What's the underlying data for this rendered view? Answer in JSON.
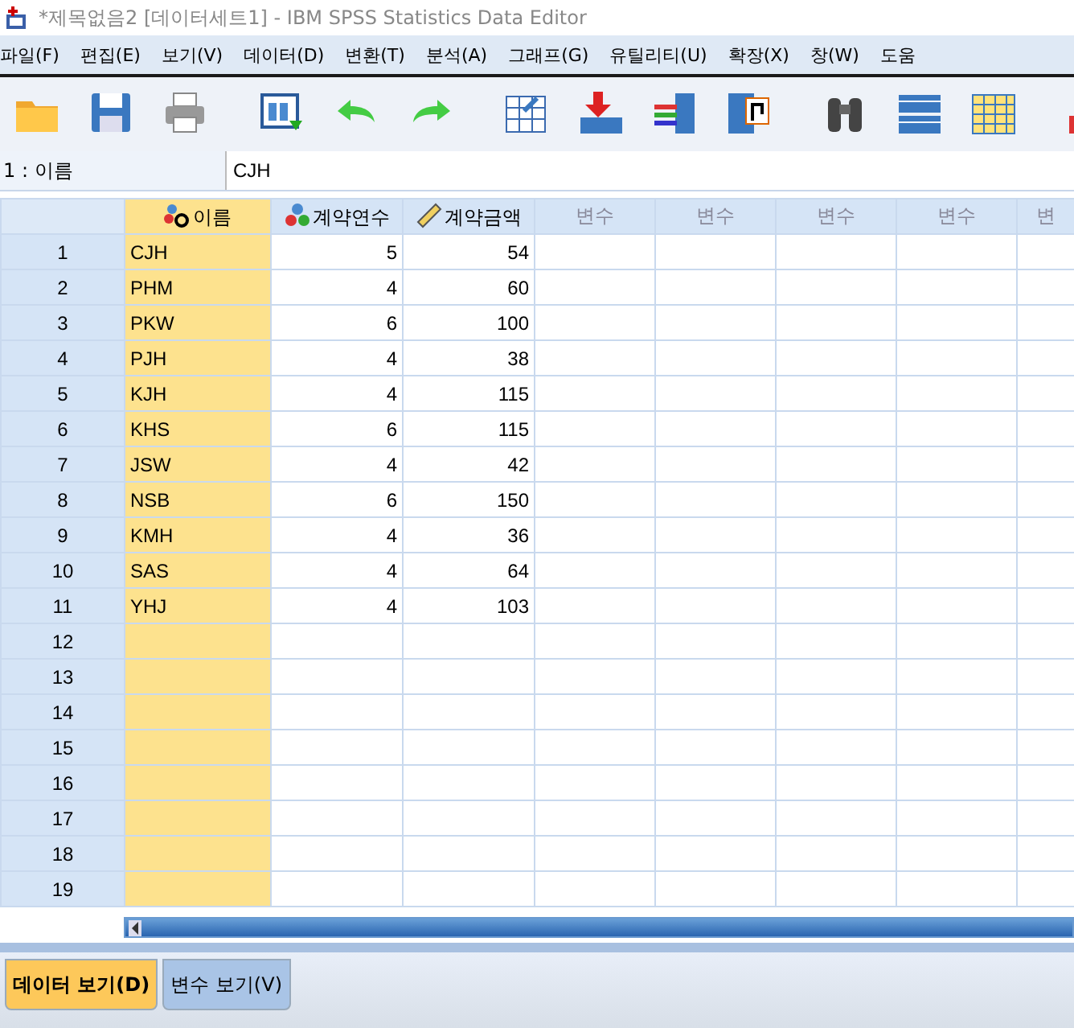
{
  "window": {
    "title": "*제목없음2 [데이터세트1] - IBM SPSS Statistics Data Editor"
  },
  "menu": [
    "파일(F)",
    "편집(E)",
    "보기(V)",
    "데이터(D)",
    "변환(T)",
    "분석(A)",
    "그래프(G)",
    "유틸리티(U)",
    "확장(X)",
    "창(W)",
    "도움"
  ],
  "cell_editor": {
    "reference": "1 : 이름",
    "value": "CJH"
  },
  "table": {
    "columns": [
      {
        "label": "이름",
        "kind": "nominal-string",
        "selected": true
      },
      {
        "label": "계약연수",
        "kind": "nominal",
        "selected": false
      },
      {
        "label": "계약금액",
        "kind": "scale",
        "selected": false
      },
      {
        "label": "변수",
        "kind": "empty",
        "selected": false
      },
      {
        "label": "변수",
        "kind": "empty",
        "selected": false
      },
      {
        "label": "변수",
        "kind": "empty",
        "selected": false
      },
      {
        "label": "변수",
        "kind": "empty",
        "selected": false
      },
      {
        "label": "변",
        "kind": "empty",
        "selected": false
      }
    ],
    "rows": [
      {
        "number": "1",
        "cells": [
          "CJH",
          "5",
          "54"
        ]
      },
      {
        "number": "2",
        "cells": [
          "PHM",
          "4",
          "60"
        ]
      },
      {
        "number": "3",
        "cells": [
          "PKW",
          "6",
          "100"
        ]
      },
      {
        "number": "4",
        "cells": [
          "PJH",
          "4",
          "38"
        ]
      },
      {
        "number": "5",
        "cells": [
          "KJH",
          "4",
          "115"
        ]
      },
      {
        "number": "6",
        "cells": [
          "KHS",
          "6",
          "115"
        ]
      },
      {
        "number": "7",
        "cells": [
          "JSW",
          "4",
          "42"
        ]
      },
      {
        "number": "8",
        "cells": [
          "NSB",
          "6",
          "150"
        ]
      },
      {
        "number": "9",
        "cells": [
          "KMH",
          "4",
          "36"
        ]
      },
      {
        "number": "10",
        "cells": [
          "SAS",
          "4",
          "64"
        ]
      },
      {
        "number": "11",
        "cells": [
          "YHJ",
          "4",
          "103"
        ]
      },
      {
        "number": "12"
      },
      {
        "number": "13"
      },
      {
        "number": "14"
      },
      {
        "number": "15"
      },
      {
        "number": "16"
      },
      {
        "number": "17"
      },
      {
        "number": "18"
      },
      {
        "number": "19"
      }
    ]
  },
  "tabs": [
    {
      "label": "데이터 보기(D)",
      "selected": true
    },
    {
      "label": "변수 보기(V)",
      "selected": false
    }
  ]
}
